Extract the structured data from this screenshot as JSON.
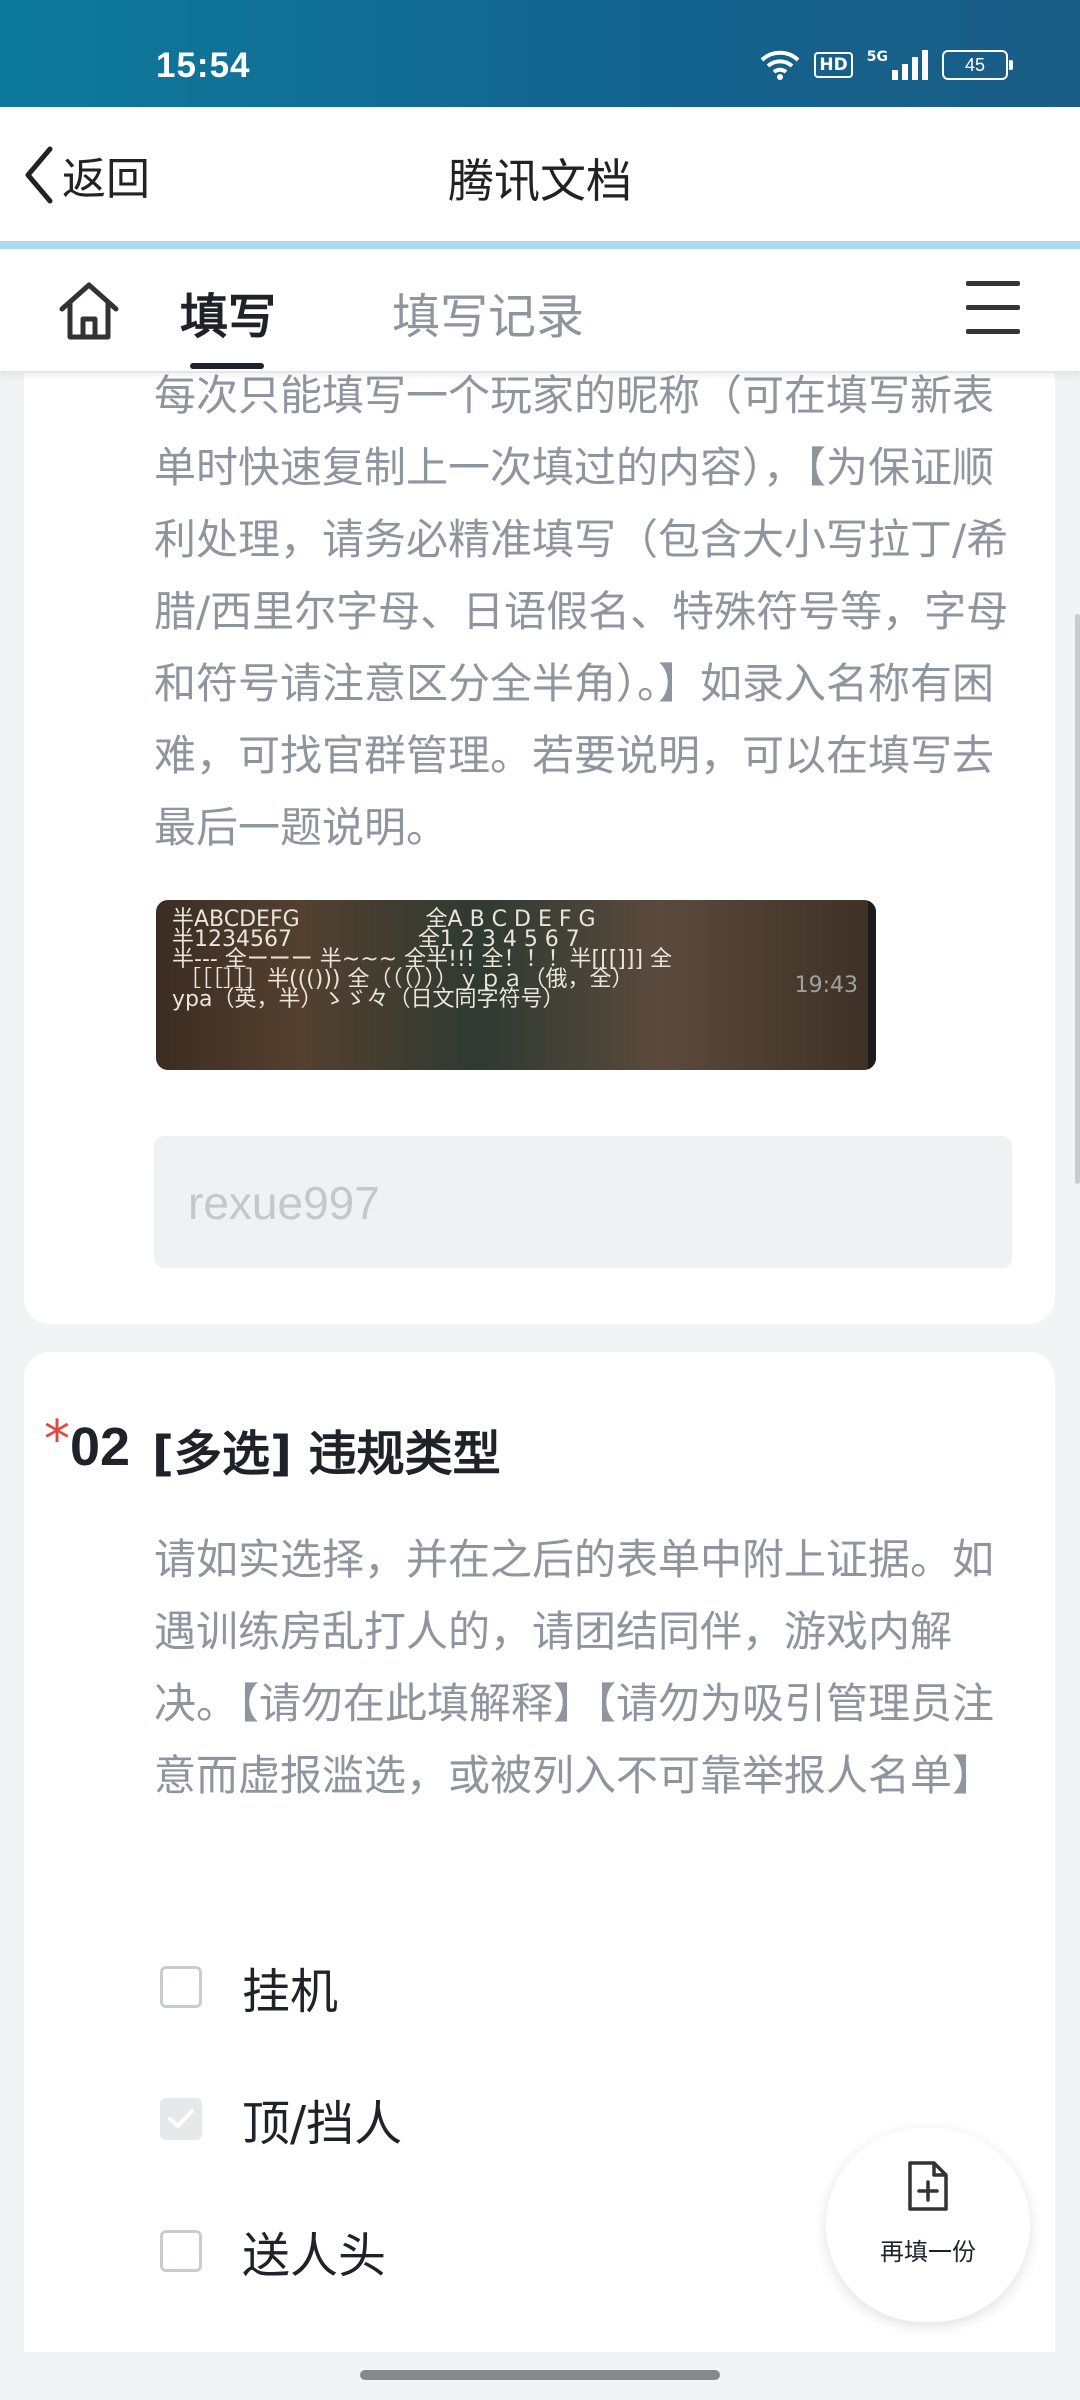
{
  "status_bar": {
    "time": "15:54",
    "hd": "HD",
    "network": "5G",
    "battery": "45"
  },
  "nav": {
    "back_label": "返回",
    "title": "腾讯文档"
  },
  "tabs": {
    "fill": "填写",
    "records": "填写记录"
  },
  "card1": {
    "description": "每次只能填写一个玩家的昵称（可在填写新表单时快速复制上一次填过的内容），【为保证顺利处理，请务必精准填写（包含大小写拉丁/希腊/西里尔字母、日语假名、特殊符号等，字母和符号请注意区分全半角）。】如录入名称有困难，可找官群管理。若要说明，可以在填写去最后一题说明。",
    "image_lines": [
      "半ABCDEFG                  全A B C D E F G",
      "半1234567                  全1 2 3 4 5 6 7",
      "半--- 全ーーー 半~~~ 全半!!! 全！！！半[[[]]] 全",
      " ［［［］］］半((())) 全（（（）））ｙｐａ（俄，全）",
      "ypa（英，半）ゝゞ々（日文同字符号）"
    ],
    "image_timestamp": "19:43",
    "input_value": "rexue997"
  },
  "card2": {
    "required_mark": "*",
    "number": "02",
    "title": "[多选] 违规类型",
    "description": "请如实选择，并在之后的表单中附上证据。如遇训练房乱打人的，请团结同伴，游戏内解决。【请勿在此填解释】【请勿为吸引管理员注意而虚报滥选，或被列入不可靠举报人名单】",
    "options": [
      {
        "label": "挂机",
        "checked": false
      },
      {
        "label": "顶/挡人",
        "checked": true
      },
      {
        "label": "送人头",
        "checked": false
      }
    ]
  },
  "fab": {
    "label": "再填一份"
  },
  "colors": {
    "accent": "#1f2329",
    "required": "#e8453c",
    "status_bar": "#13638f"
  }
}
